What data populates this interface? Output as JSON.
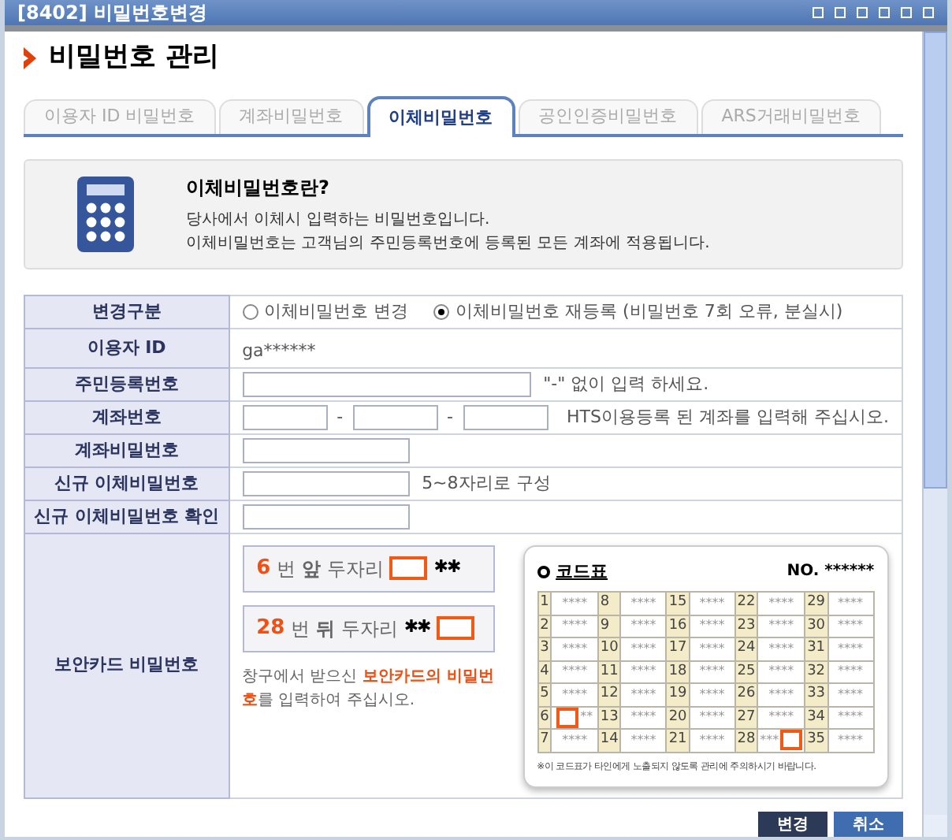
{
  "window": {
    "title": "[8402] 비밀번호변경"
  },
  "heading": "비밀번호 관리",
  "tabs": [
    {
      "label": "이용자 ID 비밀번호",
      "selected": false
    },
    {
      "label": "계좌비밀번호",
      "selected": false
    },
    {
      "label": "이체비밀번호",
      "selected": true
    },
    {
      "label": "공인인증비밀번호",
      "selected": false
    },
    {
      "label": "ARS거래비밀번호",
      "selected": false
    }
  ],
  "info": {
    "title": "이체비밀번호란?",
    "lines": [
      "당사에서 이체시 입력하는 비밀번호입니다.",
      "이체비밀번호는 고객님의 주민등록번호에 등록된 모든 계좌에 적용됩니다."
    ]
  },
  "form": [
    {
      "kind": "radio",
      "label": "변경구분",
      "options": [
        {
          "label": "이체비밀번호 변경",
          "selected": false
        },
        {
          "label": "이체비밀번호 재등록 (비밀번호 7회 오류, 분실시)",
          "selected": true
        }
      ]
    },
    {
      "kind": "text",
      "label": "이용자 ID",
      "value": "ga******"
    },
    {
      "kind": "wideinput",
      "label": "주민등록번호",
      "hint": "\"-\" 없이 입력 하세요."
    },
    {
      "kind": "account",
      "label": "계좌번호",
      "separators": [
        "-",
        "-"
      ],
      "hint": "HTS이용등록 된 계좌를 입력해 주십시오."
    },
    {
      "kind": "input",
      "label": "계좌비밀번호"
    },
    {
      "kind": "input",
      "label": "신규 이체비밀번호",
      "hint": "5~8자리로 구성"
    },
    {
      "kind": "input",
      "label": "신규 이체비밀번호 확인"
    }
  ],
  "security_card": {
    "label": "보안카드 비밀번호",
    "prompts": [
      {
        "number": "6",
        "text": "번 **앞** 두자리",
        "stars": "✱✱",
        "kind": "front"
      },
      {
        "number": "28",
        "text": "번 **뒤** 두자리",
        "stars": "✱✱",
        "kind": "back"
      }
    ],
    "note_before": "창구에서 받으신 ",
    "note_highlight": "보안카드의 비밀번호",
    "note_after": "를 입력하여 주십시오.",
    "card": {
      "title": "코드표",
      "serial": "NO. ******",
      "rows": [
        [
          {
            "no": "1",
            "code": "****"
          },
          {
            "no": "8",
            "code": "****"
          },
          {
            "no": "15",
            "code": "****"
          },
          {
            "no": "22",
            "code": "****"
          },
          {
            "no": "29",
            "code": "****"
          }
        ],
        [
          {
            "no": "2",
            "code": "****"
          },
          {
            "no": "9",
            "code": "****"
          },
          {
            "no": "16",
            "code": "****"
          },
          {
            "no": "23",
            "code": "****"
          },
          {
            "no": "30",
            "code": "****"
          }
        ],
        [
          {
            "no": "3",
            "code": "****"
          },
          {
            "no": "10",
            "code": "****"
          },
          {
            "no": "17",
            "code": "****"
          },
          {
            "no": "24",
            "code": "****"
          },
          {
            "no": "31",
            "code": "****"
          }
        ],
        [
          {
            "no": "4",
            "code": "****"
          },
          {
            "no": "11",
            "code": "****"
          },
          {
            "no": "18",
            "code": "****"
          },
          {
            "no": "25",
            "code": "****"
          },
          {
            "no": "32",
            "code": "****"
          }
        ],
        [
          {
            "no": "5",
            "code": "****"
          },
          {
            "no": "12",
            "code": "****"
          },
          {
            "no": "19",
            "code": "****"
          },
          {
            "no": "26",
            "code": "****"
          },
          {
            "no": "33",
            "code": "****"
          }
        ],
        [
          {
            "no": "6",
            "code": "**",
            "kind": "maskfront"
          },
          {
            "no": "13",
            "code": "****"
          },
          {
            "no": "20",
            "code": "****"
          },
          {
            "no": "27",
            "code": "****"
          },
          {
            "no": "34",
            "code": "****"
          }
        ],
        [
          {
            "no": "7",
            "code": "****"
          },
          {
            "no": "14",
            "code": "****"
          },
          {
            "no": "21",
            "code": "****"
          },
          {
            "no": "28",
            "code": "***",
            "kind": "maskback"
          },
          {
            "no": "35",
            "code": "****"
          }
        ]
      ],
      "footnote": "※이 코드표가 타인에게 노출되지 않도록 관리에 주의하시기 바랍니다."
    }
  },
  "buttons": [
    "변경",
    "취소"
  ]
}
